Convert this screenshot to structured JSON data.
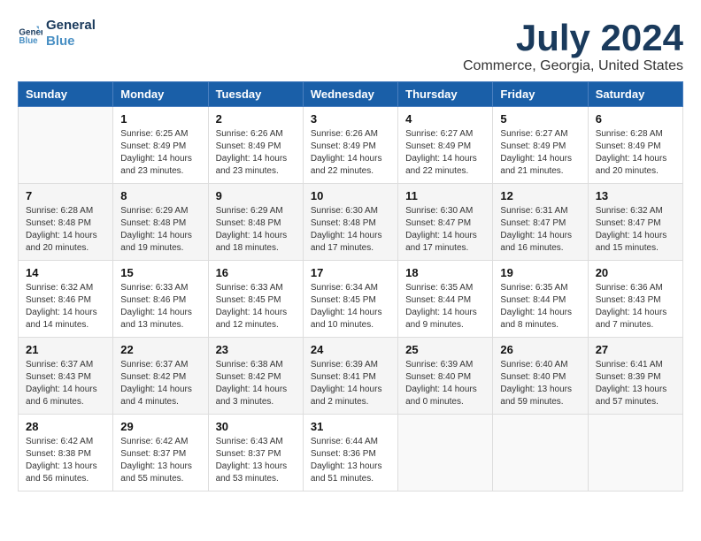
{
  "logo": {
    "text_general": "General",
    "text_blue": "Blue"
  },
  "title": "July 2024",
  "location": "Commerce, Georgia, United States",
  "weekdays": [
    "Sunday",
    "Monday",
    "Tuesday",
    "Wednesday",
    "Thursday",
    "Friday",
    "Saturday"
  ],
  "weeks": [
    [
      {
        "day": "",
        "info": ""
      },
      {
        "day": "1",
        "info": "Sunrise: 6:25 AM\nSunset: 8:49 PM\nDaylight: 14 hours\nand 23 minutes."
      },
      {
        "day": "2",
        "info": "Sunrise: 6:26 AM\nSunset: 8:49 PM\nDaylight: 14 hours\nand 23 minutes."
      },
      {
        "day": "3",
        "info": "Sunrise: 6:26 AM\nSunset: 8:49 PM\nDaylight: 14 hours\nand 22 minutes."
      },
      {
        "day": "4",
        "info": "Sunrise: 6:27 AM\nSunset: 8:49 PM\nDaylight: 14 hours\nand 22 minutes."
      },
      {
        "day": "5",
        "info": "Sunrise: 6:27 AM\nSunset: 8:49 PM\nDaylight: 14 hours\nand 21 minutes."
      },
      {
        "day": "6",
        "info": "Sunrise: 6:28 AM\nSunset: 8:49 PM\nDaylight: 14 hours\nand 20 minutes."
      }
    ],
    [
      {
        "day": "7",
        "info": "Sunrise: 6:28 AM\nSunset: 8:48 PM\nDaylight: 14 hours\nand 20 minutes."
      },
      {
        "day": "8",
        "info": "Sunrise: 6:29 AM\nSunset: 8:48 PM\nDaylight: 14 hours\nand 19 minutes."
      },
      {
        "day": "9",
        "info": "Sunrise: 6:29 AM\nSunset: 8:48 PM\nDaylight: 14 hours\nand 18 minutes."
      },
      {
        "day": "10",
        "info": "Sunrise: 6:30 AM\nSunset: 8:48 PM\nDaylight: 14 hours\nand 17 minutes."
      },
      {
        "day": "11",
        "info": "Sunrise: 6:30 AM\nSunset: 8:47 PM\nDaylight: 14 hours\nand 17 minutes."
      },
      {
        "day": "12",
        "info": "Sunrise: 6:31 AM\nSunset: 8:47 PM\nDaylight: 14 hours\nand 16 minutes."
      },
      {
        "day": "13",
        "info": "Sunrise: 6:32 AM\nSunset: 8:47 PM\nDaylight: 14 hours\nand 15 minutes."
      }
    ],
    [
      {
        "day": "14",
        "info": "Sunrise: 6:32 AM\nSunset: 8:46 PM\nDaylight: 14 hours\nand 14 minutes."
      },
      {
        "day": "15",
        "info": "Sunrise: 6:33 AM\nSunset: 8:46 PM\nDaylight: 14 hours\nand 13 minutes."
      },
      {
        "day": "16",
        "info": "Sunrise: 6:33 AM\nSunset: 8:45 PM\nDaylight: 14 hours\nand 12 minutes."
      },
      {
        "day": "17",
        "info": "Sunrise: 6:34 AM\nSunset: 8:45 PM\nDaylight: 14 hours\nand 10 minutes."
      },
      {
        "day": "18",
        "info": "Sunrise: 6:35 AM\nSunset: 8:44 PM\nDaylight: 14 hours\nand 9 minutes."
      },
      {
        "day": "19",
        "info": "Sunrise: 6:35 AM\nSunset: 8:44 PM\nDaylight: 14 hours\nand 8 minutes."
      },
      {
        "day": "20",
        "info": "Sunrise: 6:36 AM\nSunset: 8:43 PM\nDaylight: 14 hours\nand 7 minutes."
      }
    ],
    [
      {
        "day": "21",
        "info": "Sunrise: 6:37 AM\nSunset: 8:43 PM\nDaylight: 14 hours\nand 6 minutes."
      },
      {
        "day": "22",
        "info": "Sunrise: 6:37 AM\nSunset: 8:42 PM\nDaylight: 14 hours\nand 4 minutes."
      },
      {
        "day": "23",
        "info": "Sunrise: 6:38 AM\nSunset: 8:42 PM\nDaylight: 14 hours\nand 3 minutes."
      },
      {
        "day": "24",
        "info": "Sunrise: 6:39 AM\nSunset: 8:41 PM\nDaylight: 14 hours\nand 2 minutes."
      },
      {
        "day": "25",
        "info": "Sunrise: 6:39 AM\nSunset: 8:40 PM\nDaylight: 14 hours\nand 0 minutes."
      },
      {
        "day": "26",
        "info": "Sunrise: 6:40 AM\nSunset: 8:40 PM\nDaylight: 13 hours\nand 59 minutes."
      },
      {
        "day": "27",
        "info": "Sunrise: 6:41 AM\nSunset: 8:39 PM\nDaylight: 13 hours\nand 57 minutes."
      }
    ],
    [
      {
        "day": "28",
        "info": "Sunrise: 6:42 AM\nSunset: 8:38 PM\nDaylight: 13 hours\nand 56 minutes."
      },
      {
        "day": "29",
        "info": "Sunrise: 6:42 AM\nSunset: 8:37 PM\nDaylight: 13 hours\nand 55 minutes."
      },
      {
        "day": "30",
        "info": "Sunrise: 6:43 AM\nSunset: 8:37 PM\nDaylight: 13 hours\nand 53 minutes."
      },
      {
        "day": "31",
        "info": "Sunrise: 6:44 AM\nSunset: 8:36 PM\nDaylight: 13 hours\nand 51 minutes."
      },
      {
        "day": "",
        "info": ""
      },
      {
        "day": "",
        "info": ""
      },
      {
        "day": "",
        "info": ""
      }
    ]
  ]
}
